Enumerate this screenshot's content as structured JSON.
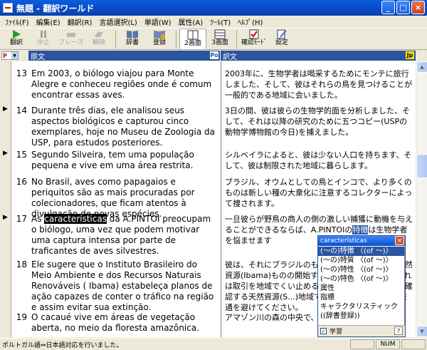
{
  "window": {
    "title": "無題 - 翻訳ワールド"
  },
  "menu": [
    "ﾌｧｲﾙ(F)",
    "編集(E)",
    "翻訳(R)",
    "言語選択(L)",
    "単語(W)",
    "属性(A)",
    "ﾂｰﾙ(T)",
    "ﾍﾙﾌﾟ(H)"
  ],
  "toolbar": {
    "translate": "翻訳",
    "stop": "中止",
    "phrase": "フレーズ",
    "release": "解除",
    "dictionary": "辞書",
    "register": "登録",
    "two_pane": "2画面",
    "three_pane": "3画面",
    "confirm_mode": "確認ﾓｰﾄﾞ",
    "settings": "設定"
  },
  "columns": {
    "source": "原文",
    "target": "訳文",
    "source_lang": "Po",
    "target_lang": "Jp",
    "dd_value": "P"
  },
  "rows": [
    {
      "num": "13",
      "src": "Em 2003, o biólogo viajou para Monte Alegre e conheceu regiões onde é comum encontrar essas aves.",
      "tgt": "2003年に、生物学者は喝采するためにモンテに旅行しました、そして、彼はそれらの鳥を見つけることが一般的である地域に会いました。"
    },
    {
      "num": "14",
      "src": "Durante três dias, ele analisou seus aspectos biológicos e capturou cinco exemplares,  hoje no Museu de Zoologia da USP, para estudos posteriores.",
      "tgt": "3日の間、彼は彼らの生物学的面を分析しました、そして、それは以降の研究のために五つコピー(USPの動物学博物館の今日)を捕えました。"
    },
    {
      "num": "15",
      "src": "Segundo Silveira, tem uma população pequena e vive em uma área restrita.",
      "tgt": "シルベイラによると、彼は少ない人口を持ちます、そして、彼は制限された地域に暮らします。"
    },
    {
      "num": "16",
      "src": "No Brasil, aves como papagaios e periquitos são as mais procuradas por colecionadores, que ficam atentos à divulgação de novas espécies.",
      "tgt": "ブラジル、オウムとしての鳥とインコで、より多くのものは新しい種の大衆化に注意するコレクターによって捜されます。"
    },
    {
      "num": "17",
      "src_pre": "As ",
      "src_hl": "características",
      "src_post": " da A.PINTOI preocupam o biólogo, uma vez que podem motivar uma captura intensa por parte de traficantes de aves silvestres.",
      "tgt_pre": "一旦彼らが野鳥の商人の側の激しい捕獲に動機を与えることができるならば、A.PINTOIの",
      "tgt_hl": "特徴",
      "tgt_post": "は生物学者を悩ませます"
    },
    {
      "num": "18",
      "src": "Ele sugere que o Instituto Brasileiro do Meio Ambiente e dos Recursos Naturais Renováveis ( Ibama) estabeleça planos de ação capazes de conter o tráfico na região e assim evitar sua extinção.",
      "tgt": "彼は、それにブラジルのものの環境と再生可能な自然資源(Ibama)ものの開始することを提案します、それは取引を地域でくい止めることができる行動計画を確認する天然資源(S...)地域で、そして、このように交通を避けてください。"
    },
    {
      "num": "19",
      "src": "O cacaué vive em áreas de vegetação aberta, no meio da floresta amazônica.",
      "tgt": "アマゾン川の森の中央で、開かれた植物"
    }
  ],
  "popup": {
    "title": "características",
    "items": [
      "(〜の)特徴 〈(of 〜)〉",
      "(〜の)特質 〈(of 〜)〉",
      "(〜の)特性 〈(of 〜)〉",
      "(〜の)特色 〈(of 〜)〉",
      "属性",
      "指標",
      "キャラクタリスティック",
      "((辞書登録))"
    ],
    "learn_label": "学習",
    "help": "?"
  },
  "status": {
    "text": "ポルトガル語⇔日本語対応を行いました。",
    "num": "NUM"
  }
}
